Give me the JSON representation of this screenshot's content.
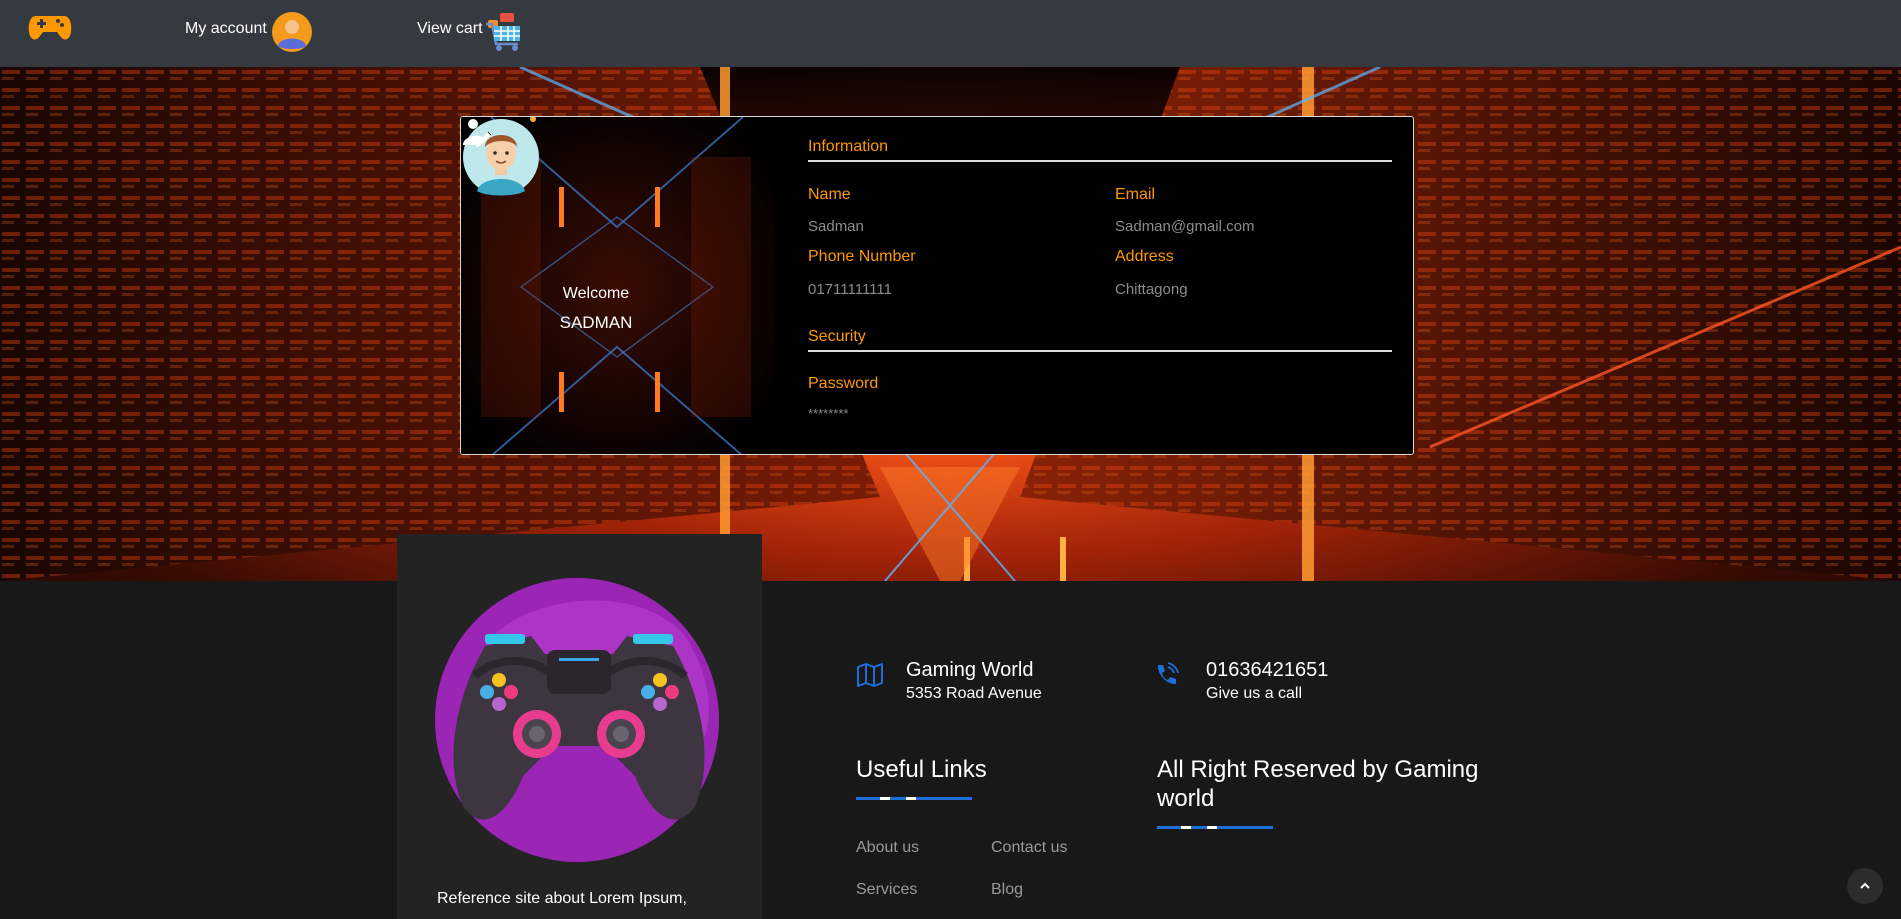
{
  "nav": {
    "logo_icon": "gamepad-icon",
    "account_label": "My account",
    "account_icon": "user-avatar-icon",
    "cart_label": "View cart",
    "cart_icon": "shopping-cart-icon"
  },
  "profile": {
    "welcome": "Welcome",
    "username": "SADMAN",
    "avatar_icon": "user-avatar-icon",
    "edit_icon": "edit-profile-icon",
    "information_title": "Information",
    "fields": {
      "name_label": "Name",
      "name_value": "Sadman",
      "email_label": "Email",
      "email_value": "Sadman@gmail.com",
      "phone_label": "Phone Number",
      "phone_value": "01711111111",
      "address_label": "Address",
      "address_value": "Chittagong"
    },
    "security_title": "Security",
    "password_label": "Password",
    "password_value": "********"
  },
  "footer": {
    "about_image_icon": "game-controller-illustration",
    "about_text": "Reference site about Lorem Ipsum,",
    "address": {
      "icon": "map-icon",
      "title": "Gaming World",
      "sub": "5353 Road Avenue"
    },
    "phone": {
      "icon": "phone-icon",
      "title": "01636421651",
      "sub": "Give us a call"
    },
    "useful_links_heading": "Useful Links",
    "links": [
      "About us",
      "Contact us",
      "Services",
      "Blog"
    ],
    "rights_heading": "All Right Reserved by Gaming world",
    "scroll_top_icon": "chevron-up-icon"
  },
  "colors": {
    "navbar": "#343a40",
    "accent": "#ff9800",
    "card_bg": "#000000",
    "footer_bg": "#181818",
    "footer_about_bg": "#232323",
    "underline": "#1e6fd9",
    "link": "#9a9a9a"
  }
}
